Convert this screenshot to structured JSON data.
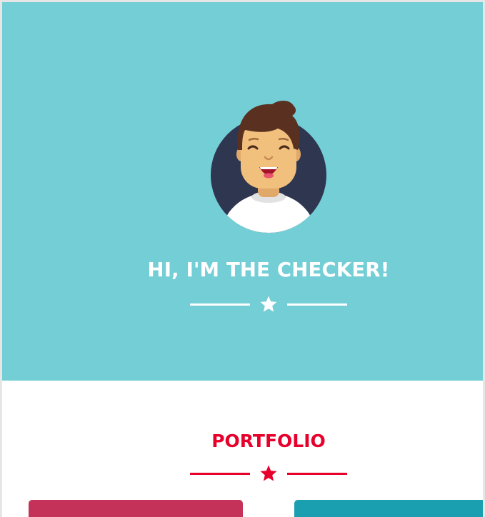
{
  "hero": {
    "title": "HI, I'M THE CHECKER!",
    "background": "#74ced6",
    "avatar_icon": "smiling-man-avatar",
    "divider_icon": "star-icon"
  },
  "portfolio": {
    "title": "PORTFOLIO",
    "accent": "#e6002b",
    "divider_icon": "star-icon",
    "cards": [
      {
        "color": "#c4325a"
      },
      {
        "color": "#1a9fb0"
      }
    ]
  }
}
